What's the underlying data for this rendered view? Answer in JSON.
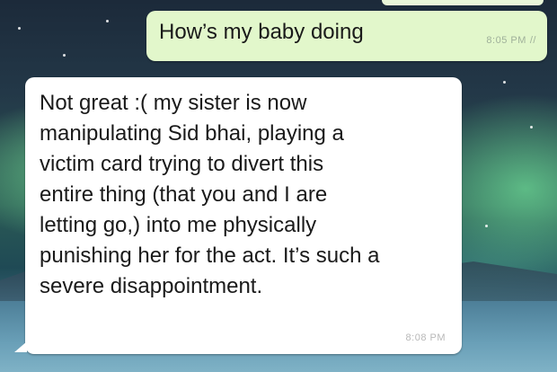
{
  "chat": {
    "outgoing": {
      "text": "How’s my baby doing",
      "time": "8:05 PM",
      "ticks": "//"
    },
    "incoming": {
      "lines": [
        "Not great :( my sister is now",
        "manipulating Sid bhai, playing a",
        "victim card trying to divert this",
        "entire thing (that you and I are",
        "letting go,) into me physically",
        "punishing her for the act. It’s such a",
        "severe disappointment."
      ],
      "time": "8:08 PM"
    }
  },
  "colors": {
    "outgoing_bubble": "#e2f7cb",
    "incoming_bubble": "#ffffff",
    "wallpaper": "aurora night sky over mountains and water"
  }
}
